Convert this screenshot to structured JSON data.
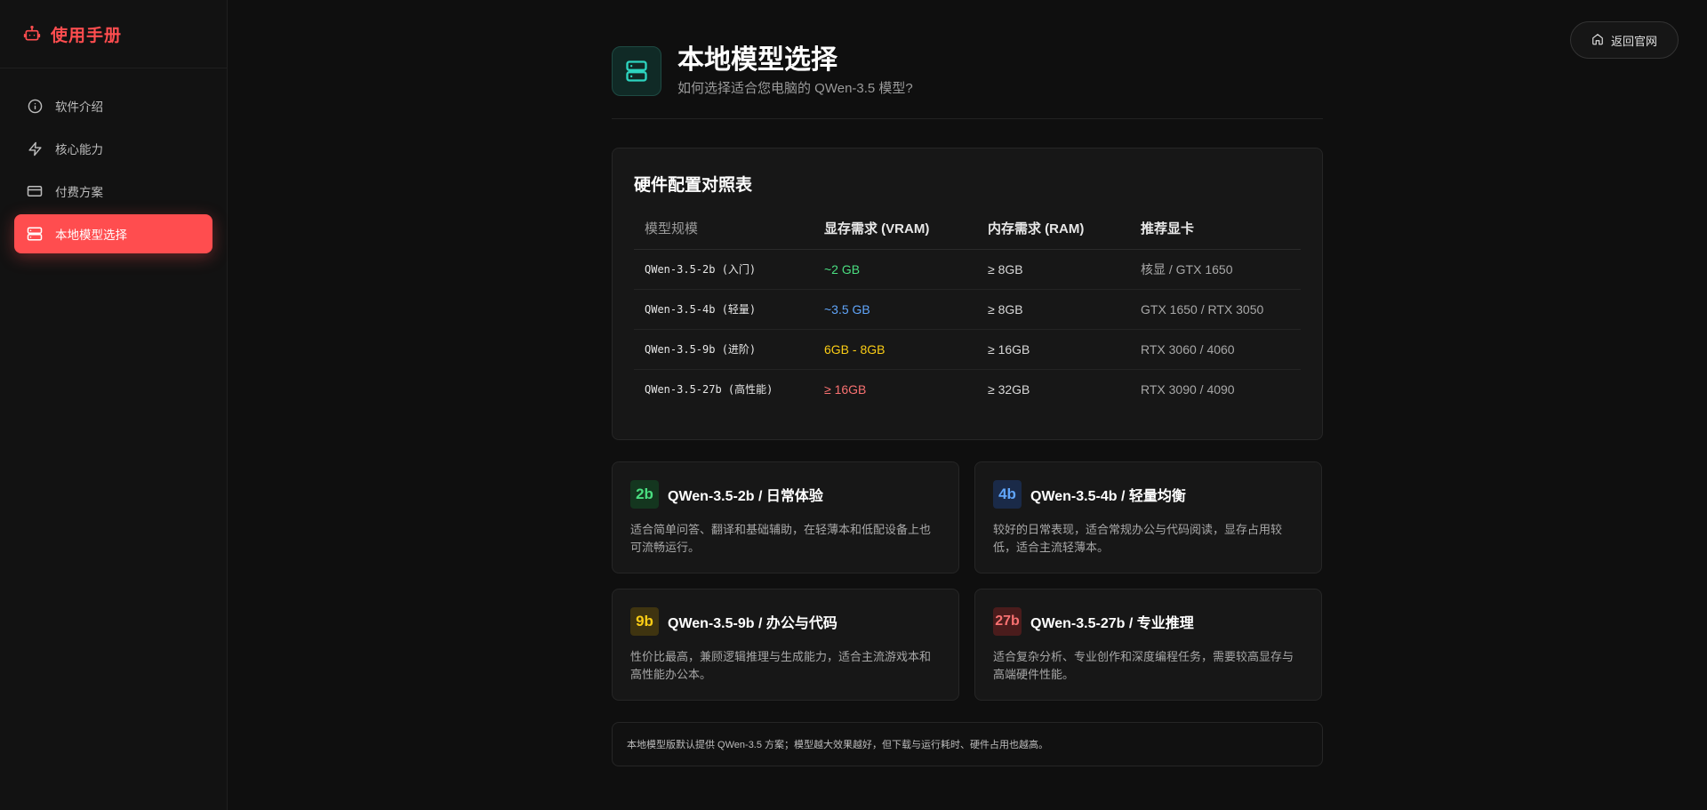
{
  "sidebar": {
    "brand": "使用手册",
    "items": [
      {
        "label": "软件介绍",
        "icon": "info-icon",
        "active": false
      },
      {
        "label": "核心能力",
        "icon": "lightning-icon",
        "active": false
      },
      {
        "label": "付费方案",
        "icon": "credit-card-icon",
        "active": false
      },
      {
        "label": "本地模型选择",
        "icon": "server-icon",
        "active": true
      }
    ]
  },
  "header": {
    "home_button": "返回官网",
    "title": "本地模型选择",
    "subtitle": "如何选择适合您电脑的 QWen-3.5 模型?"
  },
  "table": {
    "title": "硬件配置对照表",
    "columns": [
      "模型规模",
      "显存需求 (VRAM)",
      "内存需求 (RAM)",
      "推荐显卡"
    ],
    "rows": [
      {
        "model": "QWen-3.5-2b (入门)",
        "vram": "~2 GB",
        "ram": "≥ 8GB",
        "gpu": "核显 / GTX 1650"
      },
      {
        "model": "QWen-3.5-4b (轻量)",
        "vram": "~3.5 GB",
        "ram": "≥ 8GB",
        "gpu": "GTX 1650 / RTX 3050"
      },
      {
        "model": "QWen-3.5-9b (进阶)",
        "vram": "6GB - 8GB",
        "ram": "≥ 16GB",
        "gpu": "RTX 3060 / 4060"
      },
      {
        "model": "QWen-3.5-27b (高性能)",
        "vram": "≥ 16GB",
        "ram": "≥ 32GB",
        "gpu": "RTX 3090 / 4090"
      }
    ]
  },
  "cards": [
    {
      "badge": "2b",
      "title": "QWen-3.5-2b / 日常体验",
      "desc": "适合简单问答、翻译和基础辅助，在轻薄本和低配设备上也可流畅运行。"
    },
    {
      "badge": "4b",
      "title": "QWen-3.5-4b / 轻量均衡",
      "desc": "较好的日常表现，适合常规办公与代码阅读，显存占用较低，适合主流轻薄本。"
    },
    {
      "badge": "9b",
      "title": "QWen-3.5-9b / 办公与代码",
      "desc": "性价比最高，兼顾逻辑推理与生成能力，适合主流游戏本和高性能办公本。"
    },
    {
      "badge": "27b",
      "title": "QWen-3.5-27b / 专业推理",
      "desc": "适合复杂分析、专业创作和深度编程任务，需要较高显存与高端硬件性能。"
    }
  ],
  "note": "本地模型版默认提供 QWen-3.5 方案；模型越大效果越好，但下载与运行耗时、硬件占用也越高。",
  "colors": {
    "accent": "#ff4d4f",
    "green": "#4ade80",
    "blue": "#60a5fa",
    "yellow": "#facc15",
    "red": "#f87171",
    "teal": "#2dd4bf"
  }
}
